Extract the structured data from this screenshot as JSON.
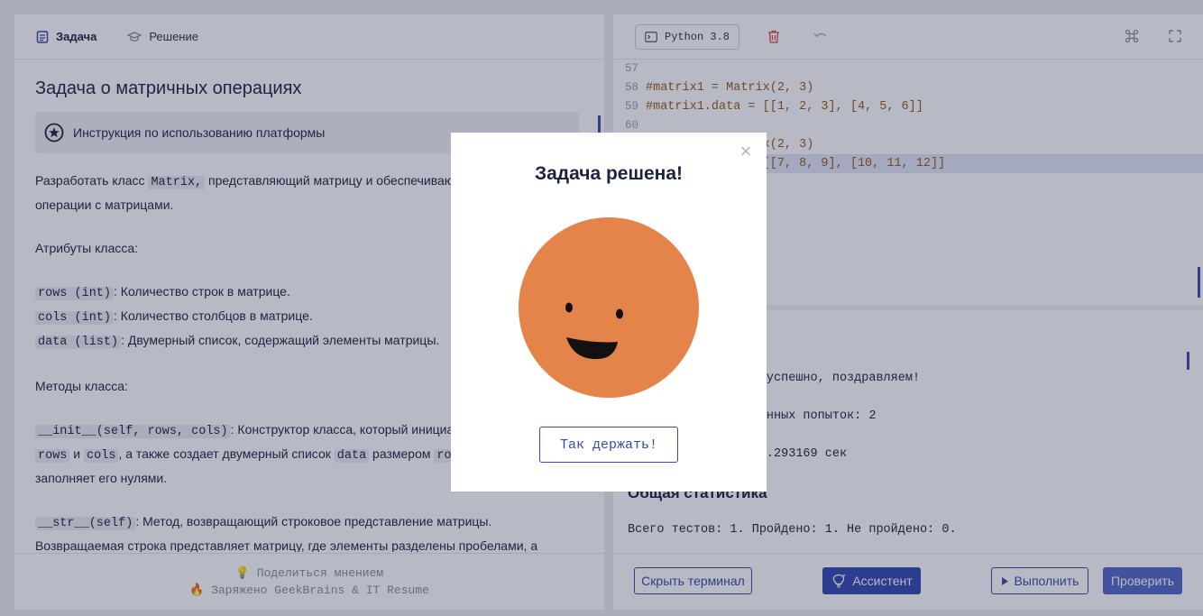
{
  "tabs": {
    "task": "Задача",
    "solution": "Решение"
  },
  "task": {
    "title": "Задача о матричных операциях",
    "instruction": "Инструкция по использованию платформы",
    "intro_a": "Разработать класс ",
    "intro_code": "Matrix,",
    "intro_b": " представляющий матрицу и обеспечивающий базовые",
    "intro_c": "операции с матрицами.",
    "attrs_title": "Атрибуты класса:",
    "attrs": [
      {
        "code": "rows (int)",
        "text": ": Количество строк в матрице."
      },
      {
        "code": "cols (int)",
        "text": ": Количество столбцов в матрице."
      },
      {
        "code": "data (list)",
        "text": ": Двумерный список, содержащий элементы матрицы."
      }
    ],
    "methods_title": "Методы класса:",
    "init_code": "__init__(self, rows, cols)",
    "init_text": ": Конструктор класса, который инициализирует",
    "init_rows": "rows",
    "init_and": " и ",
    "init_cols": "cols",
    "init_text2": ", а также создает двумерный список ",
    "init_data": "data",
    "init_text3": " размером ",
    "init_rc": "rows x cols",
    "init_text4": " и",
    "init_text5": "заполняет его нулями.",
    "str_code": "__str__(self)",
    "str_text": ": Метод, возвращающий строковое представление матрицы.",
    "str_text2": "Возвращаемая строка представляет матрицу, где элементы разделены пробелами, а"
  },
  "left_footer": {
    "feedback": "Поделиться мнением",
    "powered": "Заряжено GeekBrains & IT Resume"
  },
  "toolbar": {
    "python_version": "Python 3.8"
  },
  "editor": {
    "lines": [
      {
        "num": "57",
        "text": ""
      },
      {
        "num": "58",
        "text": "#matrix1 = Matrix(2, 3)"
      },
      {
        "num": "59",
        "text": "#matrix1.data = [[1, 2, 3], [4, 5, 6]]"
      },
      {
        "num": "60",
        "text": ""
      },
      {
        "num": "61",
        "text": "#matrix2 = Matrix(2, 3)"
      },
      {
        "num": "62",
        "text": "#matrix2.data = [[7, 8, 9], [10, 11, 12]]"
      }
    ]
  },
  "terminal": {
    "success": "Все тесты пройдены успешно, поздравляем!",
    "attempts": "Количество отправленных попыток: 2",
    "time": "Время выполнения: 0.293169 сек",
    "stats_title": "Общая статистика",
    "stats": "Всего тестов: 1. Пройдено: 1. Не пройдено: 0."
  },
  "footer": {
    "hide_terminal": "Скрыть терминал",
    "assistant": "Ассистент",
    "run": "Выполнить",
    "check": "Проверить"
  },
  "modal": {
    "title": "Задача решена!",
    "button": "Так держать!",
    "face_color": "#e5844a"
  },
  "colors": {
    "accent": "#3347b0",
    "code_string": "#9a5a14"
  }
}
